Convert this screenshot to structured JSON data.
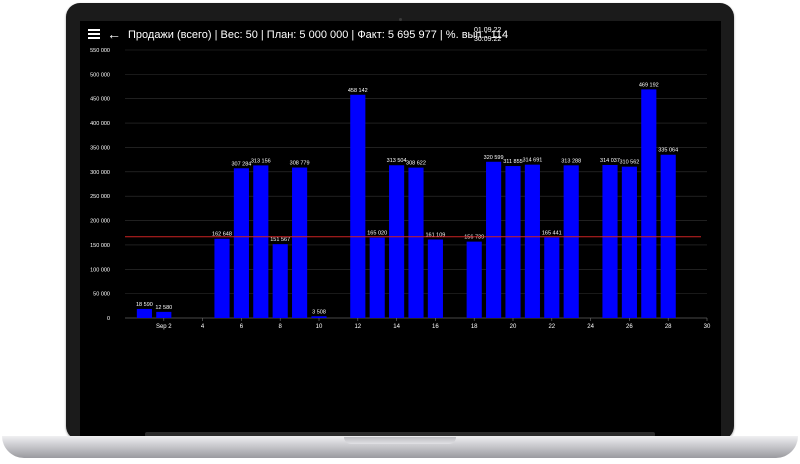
{
  "header": {
    "title": "Продажи (всего) | Вес: 50 | План: 5 000 000 | Факт: 5 695 977 | %. вып.: 114",
    "date_from": "01.09.22",
    "date_to": "30.09.22"
  },
  "colors": {
    "bar": "#0000ff",
    "plan_line": "#cc2222",
    "grid": "#333333",
    "background": "#000000",
    "text": "#ffffff"
  },
  "icons": {
    "menu": "menu-icon",
    "back": "arrow-left-icon"
  },
  "chart_data": {
    "type": "bar",
    "x": [
      1,
      2,
      5,
      6,
      7,
      8,
      9,
      10,
      12,
      13,
      14,
      15,
      16,
      18,
      19,
      20,
      21,
      22,
      23,
      25,
      26,
      27,
      28
    ],
    "values": [
      18590,
      12580,
      162648,
      307284,
      313156,
      151567,
      308779,
      3508,
      458142,
      165020,
      313504,
      308622,
      161109,
      156739,
      320599,
      311855,
      314691,
      165441,
      313288,
      314037,
      310562,
      469192,
      335064
    ],
    "data_labels": [
      "18 590",
      "12 580",
      "162 648",
      "307 284",
      "313 156",
      "151 567",
      "308 779",
      "3 508",
      "458 142",
      "165 020",
      "313 504",
      "308 622",
      "161 109",
      "156 739",
      "320 599",
      "311 855",
      "314 691",
      "165 441",
      "313 288",
      "314 037",
      "310 562",
      "469 192",
      "335 064"
    ],
    "plan_value": 166667,
    "xlim": [
      0,
      30
    ],
    "ylim": [
      0,
      550000
    ],
    "x_ticks": [
      2,
      4,
      6,
      8,
      10,
      12,
      14,
      16,
      18,
      20,
      22,
      24,
      26,
      28,
      30
    ],
    "x_tick_labels": [
      "Sep 2",
      "4",
      "6",
      "8",
      "10",
      "12",
      "14",
      "16",
      "18",
      "20",
      "22",
      "24",
      "26",
      "28",
      "30"
    ],
    "y_ticks": [
      0,
      50000,
      100000,
      150000,
      200000,
      250000,
      300000,
      350000,
      400000,
      450000,
      500000,
      550000
    ],
    "y_tick_labels": [
      "0",
      "50 000",
      "100 000",
      "150 000",
      "200 000",
      "250 000",
      "300 000",
      "350 000",
      "400 000",
      "450 000",
      "500 000",
      "550 000"
    ],
    "grid": true
  }
}
